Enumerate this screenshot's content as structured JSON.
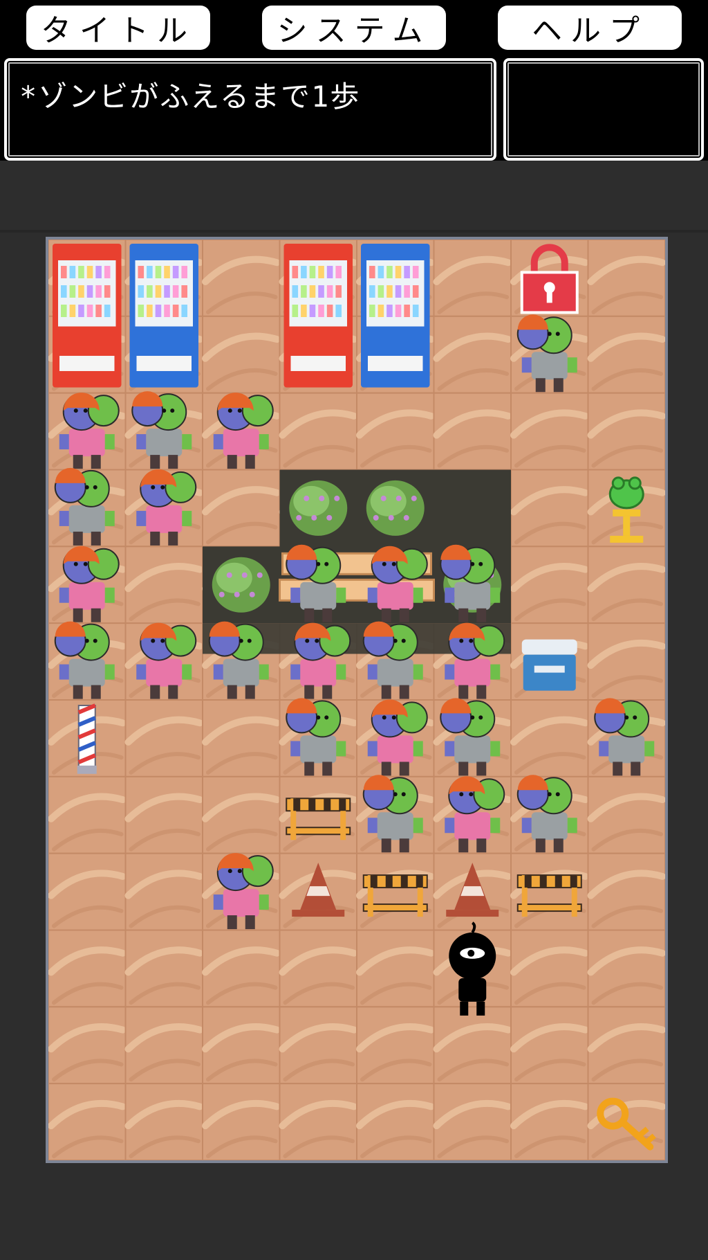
{
  "menu": {
    "title_label": "タイトル",
    "system_label": "システム",
    "help_label": "ヘルプ"
  },
  "message": "*ゾンビがふえるまで1歩",
  "status_text": "",
  "board": {
    "cols": 8,
    "rows": 12,
    "colors": {
      "floor": "#d7a07d",
      "floor_light": "#e7bc98",
      "floor_dark": "#c48a66",
      "grass": "#3b3a33",
      "zombie_skin": "#6fbf4a",
      "zombie_hair": "#e5652a",
      "zombie_shirt_f": "#e876a8",
      "zombie_shirt_m": "#9aa0a3",
      "zombie_face_f": "#6b6fc9",
      "lock": "#e43b48",
      "key": "#f2a31b",
      "vending_red": "#e8402f",
      "vending_blue": "#2f72d9",
      "cone": "#b34e37",
      "barricade": "#f0a63a",
      "frog": "#4fc44a",
      "trophy": "#f4c430",
      "box": "#3c86c8"
    },
    "objects": [
      {
        "type": "vending-machine",
        "variant": "red",
        "col": 0,
        "row": 0
      },
      {
        "type": "vending-machine",
        "variant": "blue",
        "col": 1,
        "row": 0
      },
      {
        "type": "vending-machine",
        "variant": "red",
        "col": 3,
        "row": 0
      },
      {
        "type": "vending-machine",
        "variant": "blue",
        "col": 4,
        "row": 0
      },
      {
        "type": "lock",
        "col": 6,
        "row": 0
      },
      {
        "type": "zombie",
        "variant": "m",
        "col": 6,
        "row": 1
      },
      {
        "type": "zombie",
        "variant": "f",
        "col": 0,
        "row": 2
      },
      {
        "type": "zombie",
        "variant": "m",
        "col": 1,
        "row": 2
      },
      {
        "type": "zombie",
        "variant": "f",
        "col": 2,
        "row": 2
      },
      {
        "type": "bush",
        "col": 3,
        "row": 3
      },
      {
        "type": "bush",
        "col": 4,
        "row": 3
      },
      {
        "type": "zombie",
        "variant": "m",
        "col": 0,
        "row": 3
      },
      {
        "type": "zombie",
        "variant": "f",
        "col": 1,
        "row": 3
      },
      {
        "type": "frog-statue",
        "col": 7,
        "row": 3
      },
      {
        "type": "bush",
        "col": 2,
        "row": 4
      },
      {
        "type": "bench",
        "col": 3,
        "row": 4
      },
      {
        "type": "bush",
        "col": 5,
        "row": 4
      },
      {
        "type": "zombie",
        "variant": "f",
        "col": 0,
        "row": 4
      },
      {
        "type": "zombie",
        "variant": "m",
        "col": 3,
        "row": 4
      },
      {
        "type": "zombie",
        "variant": "f",
        "col": 4,
        "row": 4
      },
      {
        "type": "zombie",
        "variant": "m",
        "col": 5,
        "row": 4
      },
      {
        "type": "zombie",
        "variant": "m",
        "col": 0,
        "row": 5
      },
      {
        "type": "zombie",
        "variant": "f",
        "col": 1,
        "row": 5
      },
      {
        "type": "zombie",
        "variant": "m",
        "col": 2,
        "row": 5
      },
      {
        "type": "zombie",
        "variant": "f",
        "col": 3,
        "row": 5
      },
      {
        "type": "zombie",
        "variant": "m",
        "col": 4,
        "row": 5
      },
      {
        "type": "zombie",
        "variant": "f",
        "col": 5,
        "row": 5
      },
      {
        "type": "cooler-box",
        "col": 6,
        "row": 5
      },
      {
        "type": "barber-pole",
        "col": 0,
        "row": 6
      },
      {
        "type": "zombie",
        "variant": "m",
        "col": 3,
        "row": 6
      },
      {
        "type": "zombie",
        "variant": "f",
        "col": 4,
        "row": 6
      },
      {
        "type": "zombie",
        "variant": "m",
        "col": 5,
        "row": 6
      },
      {
        "type": "zombie",
        "variant": "m",
        "col": 7,
        "row": 6
      },
      {
        "type": "barricade",
        "col": 3,
        "row": 7
      },
      {
        "type": "zombie",
        "variant": "m",
        "col": 4,
        "row": 7
      },
      {
        "type": "zombie",
        "variant": "f",
        "col": 5,
        "row": 7
      },
      {
        "type": "zombie",
        "variant": "m",
        "col": 6,
        "row": 7
      },
      {
        "type": "zombie",
        "variant": "f",
        "col": 2,
        "row": 8
      },
      {
        "type": "cone",
        "col": 3,
        "row": 8
      },
      {
        "type": "barricade",
        "col": 4,
        "row": 8
      },
      {
        "type": "cone",
        "col": 5,
        "row": 8
      },
      {
        "type": "barricade",
        "col": 6,
        "row": 8
      },
      {
        "type": "player",
        "col": 5,
        "row": 9
      },
      {
        "type": "key",
        "col": 7,
        "row": 11
      }
    ]
  }
}
